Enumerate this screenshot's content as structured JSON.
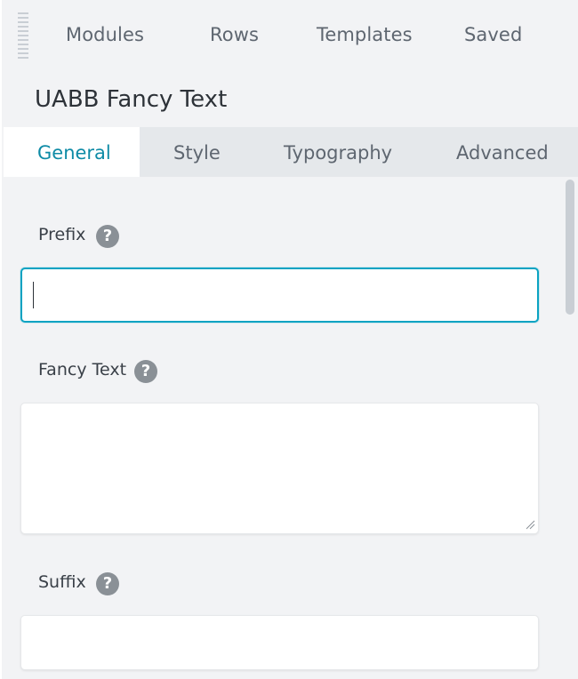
{
  "nav": {
    "items": [
      {
        "label": "Modules"
      },
      {
        "label": "Rows"
      },
      {
        "label": "Templates"
      },
      {
        "label": "Saved"
      }
    ]
  },
  "module": {
    "title": "UABB Fancy Text"
  },
  "tabs": [
    {
      "label": "General",
      "active": true
    },
    {
      "label": "Style",
      "active": false
    },
    {
      "label": "Typography",
      "active": false
    },
    {
      "label": "Advanced",
      "active": false
    }
  ],
  "fields": {
    "prefix": {
      "label": "Prefix",
      "value": "",
      "help_glyph": "?"
    },
    "fancy_text": {
      "label": "Fancy Text",
      "value": "",
      "help_glyph": "?"
    },
    "suffix": {
      "label": "Suffix",
      "value": "",
      "help_glyph": "?"
    }
  },
  "colors": {
    "accent": "#0e8ba6",
    "focus_border": "#0aa3c2",
    "panel_bg": "#f2f3f5",
    "tabs_bg": "#e5e8eb"
  }
}
